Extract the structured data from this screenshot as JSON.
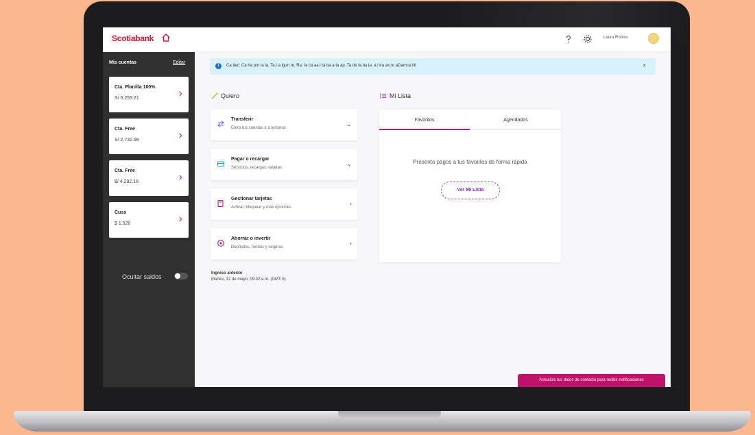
{
  "app": {
    "logo_text": "Scotiabank",
    "user_name": "Laura Robles"
  },
  "sidebar": {
    "title": "Mis cuentas",
    "edit_label": "Editar",
    "accounts": [
      {
        "name": "Cta. Planilla 100%",
        "amount": "S/ 6,253.21"
      },
      {
        "name": "Cta. Free",
        "amount": "S/ 2,732.98"
      },
      {
        "name": "Cta. Free",
        "amount": "$/ 4,292.18"
      },
      {
        "name": "Cuss",
        "amount": "$ 1,520"
      }
    ],
    "hide_balances_label": "Ocultar saldos"
  },
  "banner": {
    "text": "Ca.Ilec: Ca ha por la la. Ta.I a.lgun re, Ra. Ia ca aa.l ta ba a ta ap. Ta de la.ba Ia. a.l tra an.to aDamca.Nt",
    "close": "×"
  },
  "options_section": {
    "heading": "Quiero",
    "items": [
      {
        "title": "Transferir",
        "desc": "Entre tus cuentas o a terceros"
      },
      {
        "title": "Pagar o recargar",
        "desc": "Servicios, recargas, tarjetas"
      },
      {
        "title": "Gestionar tarjetas",
        "desc": "Activar, bloquear y más opciones"
      },
      {
        "title": "Ahorrar o invertir",
        "desc": "Depósitos, fondos y seguros"
      }
    ],
    "arrows": [
      "⌄",
      "⌄",
      "›",
      "›"
    ]
  },
  "last_access": {
    "label": "Ingreso anterior",
    "detail": "Martes, 12 de mayo, 09:32 a.m. (GMT-5)"
  },
  "my_list": {
    "heading": "Mi Lista",
    "tabs": [
      "Favoritos",
      "Agendados"
    ],
    "empty_text": "Presenta pagos a tus favoritos de forma rápida",
    "add_button": "Ver Mi Lista"
  },
  "cta": {
    "label": "Actualiza tus datos de contacto para recibir notificaciones"
  },
  "colors": {
    "brand_red": "#e3122d",
    "accent_purple": "#8c2be2",
    "cta_magenta": "#c0126a",
    "sidebar_dark": "#303030",
    "banner_blue": "#d9f1fb"
  }
}
